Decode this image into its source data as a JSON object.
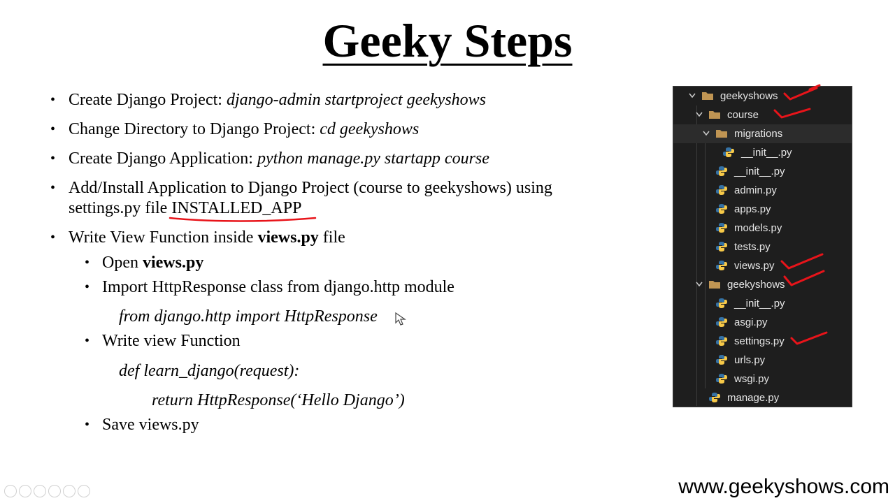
{
  "slide": {
    "title": "Geeky Steps",
    "bullets": {
      "b1": {
        "prefix": "Create Django Project: ",
        "cmd": "django-admin startproject geekyshows"
      },
      "b2": {
        "prefix": "Change Directory to Django Project: ",
        "cmd": "cd geekyshows"
      },
      "b3": {
        "prefix": "Create Django Application: ",
        "cmd": "python manage.py startapp course"
      },
      "b4": {
        "line1": "Add/Install Application to Django Project (course to geekyshows) using",
        "line2_prefix": "settings.py file ",
        "line2_highlight": "INSTALLED_APP"
      },
      "b5": {
        "prefix": "Write View Function inside ",
        "bold": "views.py",
        "suffix": " file"
      },
      "s1": {
        "prefix": "Open ",
        "bold": "views.py"
      },
      "s2": {
        "text": "Import HttpResponse class from django.http module"
      },
      "s2_code": "from django.http import HttpResponse",
      "s3": {
        "text": "Write view Function"
      },
      "s3_code1": "def learn_django(request):",
      "s3_code2": "return HttpResponse(‘Hello Django’)",
      "s4": {
        "text": "Save views.py"
      }
    },
    "bullet_char": "•",
    "footer": "www.geekyshows.com"
  },
  "explorer": {
    "items": [
      {
        "label": "geekyshows",
        "type": "folder",
        "expanded": true,
        "checked": true
      },
      {
        "label": "course",
        "type": "folder",
        "expanded": true,
        "checked": true
      },
      {
        "label": "migrations",
        "type": "folder",
        "expanded": true,
        "checked": false
      },
      {
        "label": "__init__.py",
        "type": "python",
        "checked": false
      },
      {
        "label": "__init__.py",
        "type": "python",
        "checked": false
      },
      {
        "label": "admin.py",
        "type": "python",
        "checked": false
      },
      {
        "label": "apps.py",
        "type": "python",
        "checked": false
      },
      {
        "label": "models.py",
        "type": "python",
        "checked": false
      },
      {
        "label": "tests.py",
        "type": "python",
        "checked": false
      },
      {
        "label": "views.py",
        "type": "python",
        "checked": true
      },
      {
        "label": "geekyshows",
        "type": "folder",
        "expanded": true,
        "checked": true
      },
      {
        "label": "__init__.py",
        "type": "python",
        "checked": false
      },
      {
        "label": "asgi.py",
        "type": "python",
        "checked": false
      },
      {
        "label": "settings.py",
        "type": "python",
        "checked": true
      },
      {
        "label": "urls.py",
        "type": "python",
        "checked": false
      },
      {
        "label": "wsgi.py",
        "type": "python",
        "checked": false
      },
      {
        "label": "manage.py",
        "type": "python",
        "checked": false
      }
    ]
  },
  "colors": {
    "annotation_red": "#e8141a",
    "panel_bg": "#1e1e1e",
    "folder": "#c09553",
    "python_blue": "#3572a5",
    "python_yellow": "#f7c948"
  },
  "icons": {
    "folder": "folder-icon",
    "python": "python-file-icon",
    "chevron": "chevron-down-icon",
    "check": "red-checkmark-icon",
    "cursor": "mouse-cursor-icon"
  }
}
